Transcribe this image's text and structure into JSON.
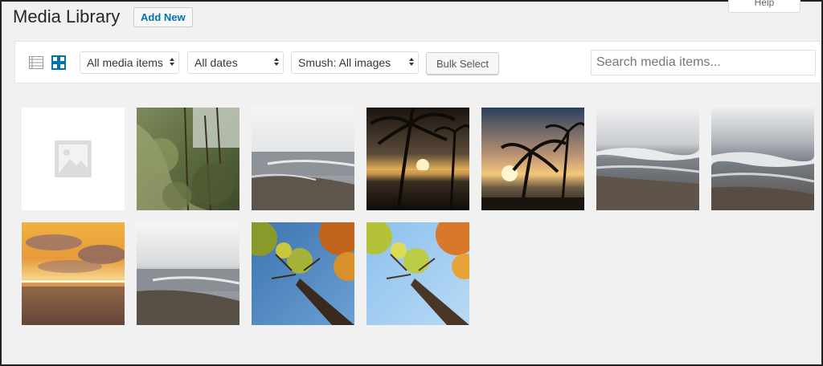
{
  "help_tab": "Help",
  "page_title": "Media Library",
  "add_new_label": "Add New",
  "toolbar": {
    "list_view_icon": "list-view-icon",
    "grid_view_icon": "grid-view-icon",
    "filter_media": "All media items",
    "filter_dates": "All dates",
    "filter_smush": "Smush: All images",
    "bulk_select": "Bulk Select",
    "search_placeholder": "Search media items..."
  },
  "colors": {
    "accent": "#0073aa",
    "background": "#f1f1f1"
  },
  "media_items": [
    {
      "kind": "placeholder",
      "icon": "image-placeholder-icon"
    },
    {
      "kind": "forest"
    },
    {
      "kind": "beach-overcast"
    },
    {
      "kind": "palm-sunset-1"
    },
    {
      "kind": "palm-sunset-2"
    },
    {
      "kind": "beach-waves-1"
    },
    {
      "kind": "beach-waves-2"
    },
    {
      "kind": "ocean-sunset"
    },
    {
      "kind": "beach-overcast-2"
    },
    {
      "kind": "tree-sky-1"
    },
    {
      "kind": "tree-sky-2"
    }
  ]
}
